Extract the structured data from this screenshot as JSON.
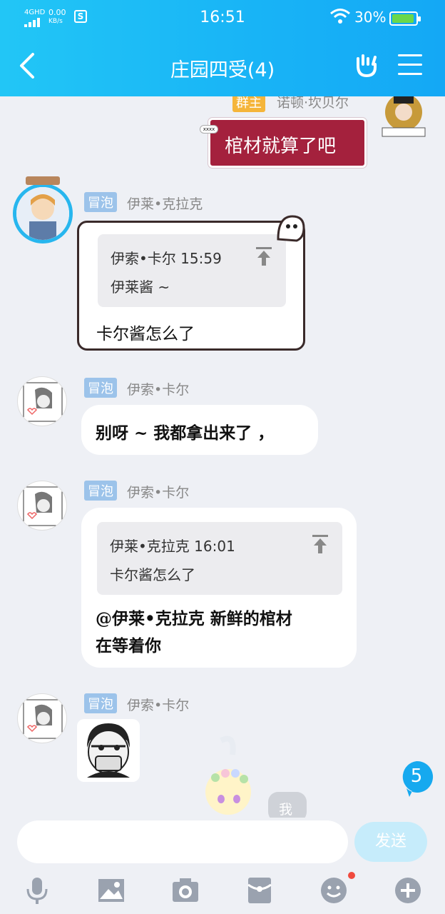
{
  "status_bar": {
    "network": "4GHD",
    "speed_value": "0.00",
    "speed_unit": "KB/s",
    "time": "16:51",
    "battery": "30%"
  },
  "header": {
    "title": "庄园四受(4)",
    "icons": [
      "back-arrow-icon",
      "hand-gesture-icon",
      "menu-icon"
    ]
  },
  "messages": [
    {
      "sender_role": "群主",
      "sender": "诺顿·坎贝尔",
      "text": "棺材就算了吧"
    },
    {
      "tag": "冒泡",
      "sender": "伊莱•克拉克",
      "quote": {
        "author": "伊索•卡尔",
        "time": "15:59",
        "text": "伊莱酱 ~"
      },
      "text": "卡尔酱怎么了"
    },
    {
      "tag": "冒泡",
      "sender": "伊索•卡尔",
      "text": "别呀 ~ 我都拿出来了 ，"
    },
    {
      "tag": "冒泡",
      "sender": "伊索•卡尔",
      "quote": {
        "author": "伊莱•克拉克",
        "time": "16:01",
        "text": "卡尔酱怎么了"
      },
      "text_line1": "@伊莱•克拉克 新鲜的棺材",
      "text_line2": "在等着你"
    },
    {
      "tag": "冒泡",
      "sender": "伊索•卡尔",
      "sticker": "masked-face-sticker"
    },
    {
      "partial_text": "我"
    }
  ],
  "unread_count": "5",
  "input": {
    "placeholder": "",
    "send_label": "发送"
  },
  "toolbar": [
    "microphone-icon",
    "image-icon",
    "camera-icon",
    "red-packet-icon",
    "emoji-icon",
    "plus-icon"
  ],
  "colors": {
    "header": "#18b3f6",
    "background": "#eef0f5",
    "red_bubble": "#a4213d",
    "tag": "#9cc3ea",
    "send_disabled": "#c6ecfb"
  }
}
